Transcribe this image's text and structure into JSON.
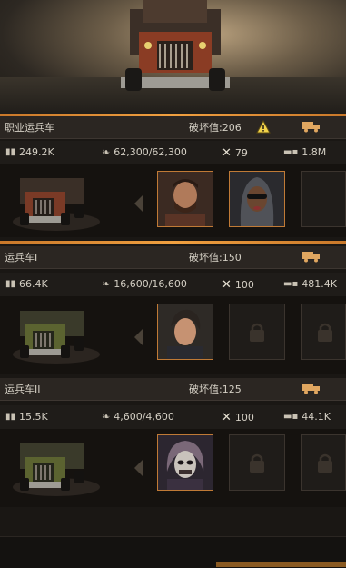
{
  "sections": [
    {
      "title": "职业运兵车",
      "damage": "破坏值:206",
      "stats": {
        "troops": "249.2K",
        "load": "62,300/62,300",
        "repair": "79",
        "speed": "1.8M"
      },
      "slots": [
        "hero",
        "hero",
        "locked"
      ],
      "truck_color": "#7a3a26"
    },
    {
      "title": "运兵车I",
      "damage": "破坏值:150",
      "stats": {
        "troops": "66.4K",
        "load": "16,600/16,600",
        "repair": "100",
        "speed": "481.4K"
      },
      "slots": [
        "hero",
        "locked",
        "locked"
      ],
      "truck_color": "#5b6330"
    },
    {
      "title": "运兵车II",
      "damage": "破坏值:125",
      "stats": {
        "troops": "15.5K",
        "load": "4,600/4,600",
        "repair": "100",
        "speed": "44.1K"
      },
      "slots": [
        "hero",
        "locked",
        "locked"
      ],
      "truck_color": "#5b6330"
    }
  ],
  "colors": {
    "accent": "#e89a3c",
    "frame": "#c07a36"
  },
  "icons": [
    "warning-icon",
    "truck-icon",
    "troops-icon",
    "wing-icon",
    "repair-icon",
    "lock-icon",
    "chevron-left-icon"
  ]
}
